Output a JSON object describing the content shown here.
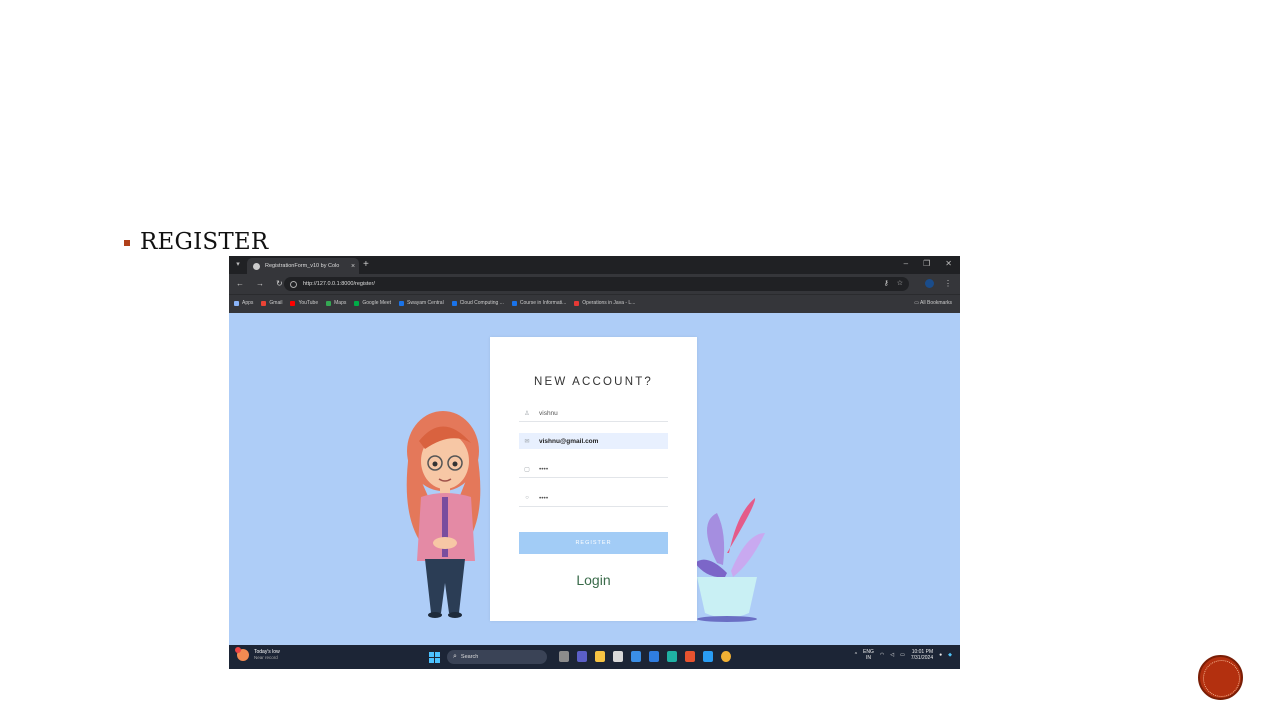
{
  "slide": {
    "bullet_text": "REGISTER"
  },
  "browser": {
    "tab_title": "RegistrationForm_v10 by Colo",
    "tab_close": "×",
    "new_tab": "+",
    "url": "http://127.0.0.1:8000/register/",
    "bookmarks": [
      {
        "label": "Apps",
        "color": "#8ab4f8"
      },
      {
        "label": "Gmail",
        "color": "#ea4335"
      },
      {
        "label": "YouTube",
        "color": "#ff0000"
      },
      {
        "label": "Maps",
        "color": "#34a853"
      },
      {
        "label": "Google Meet",
        "color": "#00ac47"
      },
      {
        "label": "Swayam Central",
        "color": "#1a73e8"
      },
      {
        "label": "Cloud Computing ...",
        "color": "#1a73e8"
      },
      {
        "label": "Course in Informati...",
        "color": "#1a73e8"
      },
      {
        "label": "Operations in Java - L...",
        "color": "#e53935"
      }
    ],
    "all_bookmarks": "All Bookmarks"
  },
  "form": {
    "title": "NEW ACCOUNT?",
    "username_value": "vishnu",
    "email_value": "vishnu@gmail.com",
    "password_value": "••••",
    "confirm_value": "••••",
    "register_label": "REGISTER",
    "login_label": "Login"
  },
  "taskbar": {
    "weather_title": "Today's low",
    "weather_sub": "Near record",
    "search_label": "Search",
    "lang_line1": "ENG",
    "lang_line2": "IN",
    "time": "10:01 PM",
    "date": "7/31/2024"
  },
  "colors": {
    "page_background": "#aecdf7",
    "accent_button": "#a2ccf6",
    "login_text": "#3a6b4a",
    "slide_accent": "#b3300f"
  }
}
